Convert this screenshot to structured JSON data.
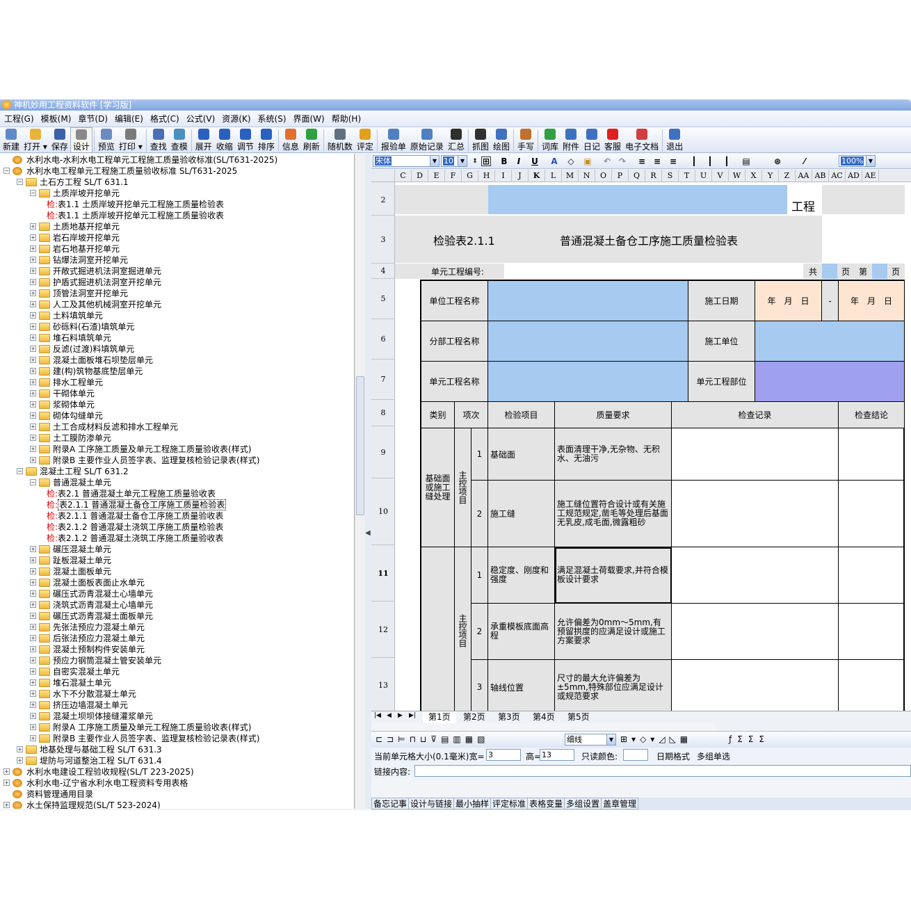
{
  "app": {
    "title": "神机妙用工程资料软件 [学习版]"
  },
  "menu": [
    "工程(G)",
    "模板(M)",
    "章节(D)",
    "编辑(E)",
    "格式(C)",
    "公式(V)",
    "资源(K)",
    "系统(S)",
    "界面(W)",
    "帮助(H)"
  ],
  "toolbar": [
    {
      "label": "新建",
      "color": "#5e8ac8"
    },
    {
      "label": "打开",
      "color": "#e9b33a",
      "dd": true
    },
    {
      "label": "保存",
      "color": "#3b64a8"
    },
    {
      "label": "设计",
      "color": "#8a8a8a",
      "pressed": true
    },
    {
      "sep": true
    },
    {
      "label": "预览",
      "color": "#6a8ac0"
    },
    {
      "label": "打印",
      "color": "#7a7a7a",
      "dd": true
    },
    {
      "sep": true
    },
    {
      "label": "查找",
      "color": "#4a6fb5"
    },
    {
      "label": "查模",
      "color": "#4a90c0"
    },
    {
      "sep": true
    },
    {
      "label": "展开",
      "color": "#2a60c0"
    },
    {
      "label": "收缩",
      "color": "#2a60c0"
    },
    {
      "label": "调节",
      "color": "#2a60c0"
    },
    {
      "label": "排序",
      "color": "#2a60c0"
    },
    {
      "sep": true
    },
    {
      "label": "信息",
      "color": "#e07030"
    },
    {
      "label": "刷新",
      "color": "#30a040"
    },
    {
      "sep": true
    },
    {
      "label": "随机数",
      "color": "#607080"
    },
    {
      "label": "评定",
      "color": "#e0a020"
    },
    {
      "sep": true
    },
    {
      "label": "报验单",
      "color": "#5080c0"
    },
    {
      "label": "原始记录",
      "color": "#5080c0"
    },
    {
      "label": "汇总",
      "color": "#303030"
    },
    {
      "sep": true
    },
    {
      "label": "抓图",
      "color": "#303030"
    },
    {
      "label": "绘图",
      "color": "#4070c0"
    },
    {
      "sep": true
    },
    {
      "label": "手写",
      "color": "#c07030"
    },
    {
      "sep": true
    },
    {
      "label": "词库",
      "color": "#30a040"
    },
    {
      "label": "附件",
      "color": "#4070c0"
    },
    {
      "label": "日记",
      "color": "#4070c0"
    },
    {
      "label": "客服",
      "color": "#e02020"
    },
    {
      "label": "电子文档",
      "color": "#d04040"
    },
    {
      "sep": true
    },
    {
      "label": "退出",
      "color": "#4070c0"
    }
  ],
  "format_bar": {
    "font": "宋体",
    "size": "10",
    "zoom": "100%",
    "bold": "B",
    "italic": "I",
    "underline": "U"
  },
  "tree": [
    {
      "t": "水利水电-水利水电工程单元工程施工质量验收标准(SL/T631-2025)",
      "lv": 0,
      "ic": "doc",
      "ex": ""
    },
    {
      "t": "水利水电工程单元工程施工质量验收标准 SL/T631-2025",
      "lv": 0,
      "ic": "doc",
      "ex": "-"
    },
    {
      "t": "土石方工程 SL/T 631.1",
      "lv": 1,
      "ic": "fold",
      "ex": "-"
    },
    {
      "t": "土质岸坡开挖单元",
      "lv": 2,
      "ic": "fold",
      "ex": "-"
    },
    {
      "t": "表1.1 土质岸坡开挖单元工程施工质量检验表",
      "lv": 3,
      "ic": "",
      "ex": "",
      "pre": "检:"
    },
    {
      "t": "表1.1 土质岸坡开挖单元工程施工质量验收表",
      "lv": 3,
      "ic": "",
      "ex": "",
      "pre": "检:"
    },
    {
      "t": "土质地基开挖单元",
      "lv": 2,
      "ic": "fold",
      "ex": "+"
    },
    {
      "t": "岩石岸坡开挖单元",
      "lv": 2,
      "ic": "fold",
      "ex": "+"
    },
    {
      "t": "岩石地基开挖单元",
      "lv": 2,
      "ic": "fold",
      "ex": "+"
    },
    {
      "t": "钻爆法洞室开挖单元",
      "lv": 2,
      "ic": "fold",
      "ex": "+"
    },
    {
      "t": "开敞式掘进机法洞室掘进单元",
      "lv": 2,
      "ic": "fold",
      "ex": "+"
    },
    {
      "t": "护盾式掘进机法洞室开挖单元",
      "lv": 2,
      "ic": "fold",
      "ex": "+"
    },
    {
      "t": "顶管法洞室开挖单元",
      "lv": 2,
      "ic": "fold",
      "ex": "+"
    },
    {
      "t": "人工及其他机械洞室开挖单元",
      "lv": 2,
      "ic": "fold",
      "ex": "+"
    },
    {
      "t": "土料填筑单元",
      "lv": 2,
      "ic": "fold",
      "ex": "+"
    },
    {
      "t": "砂砾料(石渣)填筑单元",
      "lv": 2,
      "ic": "fold",
      "ex": "+"
    },
    {
      "t": "堆石料填筑单元",
      "lv": 2,
      "ic": "fold",
      "ex": "+"
    },
    {
      "t": "反滤(过渡)料填筑单元",
      "lv": 2,
      "ic": "fold",
      "ex": "+"
    },
    {
      "t": "混凝土面板堆石坝垫层单元",
      "lv": 2,
      "ic": "fold",
      "ex": "+"
    },
    {
      "t": "建(构)筑物基底垫层单元",
      "lv": 2,
      "ic": "fold",
      "ex": "+"
    },
    {
      "t": "排水工程单元",
      "lv": 2,
      "ic": "fold",
      "ex": "+"
    },
    {
      "t": "干砌体单元",
      "lv": 2,
      "ic": "fold",
      "ex": "+"
    },
    {
      "t": "浆砌体单元",
      "lv": 2,
      "ic": "fold",
      "ex": "+"
    },
    {
      "t": "砌体勾缝单元",
      "lv": 2,
      "ic": "fold",
      "ex": "+"
    },
    {
      "t": "土工合成材料反滤和排水工程单元",
      "lv": 2,
      "ic": "fold",
      "ex": "+"
    },
    {
      "t": "土工膜防渗单元",
      "lv": 2,
      "ic": "fold",
      "ex": "+"
    },
    {
      "t": "附录A 工序施工质量及单元工程施工质量验收表(样式)",
      "lv": 2,
      "ic": "fold",
      "ex": "+"
    },
    {
      "t": "附录B 主要作业人员签字表、监理复核检验记录表(样式)",
      "lv": 2,
      "ic": "fold",
      "ex": "+"
    },
    {
      "t": "混凝土工程 SL/T 631.2",
      "lv": 1,
      "ic": "fold",
      "ex": "-"
    },
    {
      "t": "普通混凝土单元",
      "lv": 2,
      "ic": "fold",
      "ex": "-"
    },
    {
      "t": "表2.1 普通混凝土单元工程施工质量验收表",
      "lv": 3,
      "ic": "",
      "ex": "",
      "pre": "检:"
    },
    {
      "t": "表2.1.1 普通混凝土备仓工序施工质量检验表",
      "lv": 3,
      "ic": "",
      "ex": "",
      "pre": "检:",
      "sel": true
    },
    {
      "t": "表2.1.1 普通混凝土备仓工序施工质量验收表",
      "lv": 3,
      "ic": "",
      "ex": "",
      "pre": "检:"
    },
    {
      "t": "表2.1.2 普通混凝土浇筑工序施工质量检验表",
      "lv": 3,
      "ic": "",
      "ex": "",
      "pre": "检:"
    },
    {
      "t": "表2.1.2 普通混凝土浇筑工序施工质量验收表",
      "lv": 3,
      "ic": "",
      "ex": "",
      "pre": "检:"
    },
    {
      "t": "碾压混凝土单元",
      "lv": 2,
      "ic": "fold",
      "ex": "+"
    },
    {
      "t": "趾板混凝土单元",
      "lv": 2,
      "ic": "fold",
      "ex": "+"
    },
    {
      "t": "混凝土面板单元",
      "lv": 2,
      "ic": "fold",
      "ex": "+"
    },
    {
      "t": "混凝土面板表面止水单元",
      "lv": 2,
      "ic": "fold",
      "ex": "+"
    },
    {
      "t": "碾压式沥青混凝土心墙单元",
      "lv": 2,
      "ic": "fold",
      "ex": "+"
    },
    {
      "t": "浇筑式沥青混凝土心墙单元",
      "lv": 2,
      "ic": "fold",
      "ex": "+"
    },
    {
      "t": "碾压式沥青混凝土面板单元",
      "lv": 2,
      "ic": "fold",
      "ex": "+"
    },
    {
      "t": "先张法预应力混凝土单元",
      "lv": 2,
      "ic": "fold",
      "ex": "+"
    },
    {
      "t": "后张法预应力混凝土单元",
      "lv": 2,
      "ic": "fold",
      "ex": "+"
    },
    {
      "t": "混凝土预制构件安装单元",
      "lv": 2,
      "ic": "fold",
      "ex": "+"
    },
    {
      "t": "预应力钢筒混凝土管安装单元",
      "lv": 2,
      "ic": "fold",
      "ex": "+"
    },
    {
      "t": "自密实混凝土单元",
      "lv": 2,
      "ic": "fold",
      "ex": "+"
    },
    {
      "t": "堆石混凝土单元",
      "lv": 2,
      "ic": "fold",
      "ex": "+"
    },
    {
      "t": "水下不分散混凝土单元",
      "lv": 2,
      "ic": "fold",
      "ex": "+"
    },
    {
      "t": "挤压边墙混凝土单元",
      "lv": 2,
      "ic": "fold",
      "ex": "+"
    },
    {
      "t": "混凝土坝坝体接缝灌浆单元",
      "lv": 2,
      "ic": "fold",
      "ex": "+"
    },
    {
      "t": "附录A 工序施工质量及单元工程施工质量验收表(样式)",
      "lv": 2,
      "ic": "fold",
      "ex": "+"
    },
    {
      "t": "附录B 主要作业人员签字表、监理复核检验记录表(样式)",
      "lv": 2,
      "ic": "fold",
      "ex": "+"
    },
    {
      "t": "地基处理与基础工程 SL/T 631.3",
      "lv": 1,
      "ic": "fold",
      "ex": "+"
    },
    {
      "t": "堤防与河道整治工程 SL/T 631.4",
      "lv": 1,
      "ic": "fold",
      "ex": "+"
    },
    {
      "t": "水利水电建设工程验收规程(SL/T 223-2025)",
      "lv": 0,
      "ic": "doc",
      "ex": "+"
    },
    {
      "t": "水利水电-辽宁省水利水电工程资料专用表格",
      "lv": 0,
      "ic": "doc",
      "ex": "+"
    },
    {
      "t": "资料管理通用目录",
      "lv": 0,
      "ic": "doc",
      "ex": ""
    },
    {
      "t": "水土保持监理规范(SL/T 523-2024)",
      "lv": 0,
      "ic": "doc",
      "ex": "+"
    }
  ],
  "columns": [
    "C",
    "D",
    "E",
    "F",
    "G",
    "H",
    "I",
    "J",
    "K",
    "L",
    "M",
    "N",
    "O",
    "P",
    "Q",
    "R",
    "S",
    "T",
    "U",
    "V",
    "W",
    "X",
    "Y",
    "Z",
    "AA",
    "AB",
    "AC",
    "AD",
    "AE"
  ],
  "rows": [
    "2",
    "3",
    "4",
    "5",
    "6",
    "7",
    "8",
    "9",
    "10",
    "11",
    "12",
    "13"
  ],
  "form": {
    "suffix": "工程",
    "table_no": "检验表2.1.1",
    "title": "普通混凝土备仓工序施工质量检验表",
    "unit_no_label": "单元工程编号:",
    "total": "共",
    "page": "页",
    "page_no": "第",
    "page2": "页",
    "unit_project": "单位工程名称",
    "start_date": "施工日期",
    "date1": "年　月　日",
    "dash": "-",
    "date2": "年　月　日",
    "sub_project": "分部工程名称",
    "contractor": "施工单位",
    "unit_name": "单元工程名称",
    "unit_part": "单元工程部位",
    "h_cat": "类别",
    "h_item": "项次",
    "h_check": "检验项目",
    "h_req": "质量要求",
    "h_record": "检查记录",
    "h_result": "检查结论",
    "cat1": "基础面或施工缝处理",
    "main1": "主控项目",
    "main2": "主控项目",
    "r9_no": "1",
    "r9_item": "基础面",
    "r9_req": "表面清理干净,无杂物、无积水、无油污",
    "r10_no": "2",
    "r10_item": "施工缝",
    "r10_req": "施工缝位置符合设计或有关施工规范规定,凿毛等处理后基面无乳皮,成毛面,微露粗砂",
    "r11_no": "1",
    "r11_item": "稳定度、刚度和强度",
    "r11_req": "满足混凝土荷载要求,并符合模板设计要求",
    "r12_no": "2",
    "r12_item": "承重模板底面高程",
    "r12_req": "允许偏差为0mm～5mm,有预留拱度的应满足设计或施工方案要求",
    "r13_no": "3",
    "r13_item": "轴线位置",
    "r13_req": "尺寸的最大允许偏差为±5mm,特殊部位应满足设计或规范要求"
  },
  "sheets": [
    "第1页",
    "第2页",
    "第3页",
    "第4页",
    "第5页"
  ],
  "bottom": {
    "line_style": "细线",
    "size_label": "当前单元格大小(0.1毫米)宽=",
    "w": "3",
    "h_label": "高=",
    "h": "13",
    "readonly": "只读颜色:",
    "date_fmt": "日期格式",
    "multi": "多组单选",
    "link_label": "链接内容:"
  },
  "bottom_tabs": [
    "备忘记事",
    "设计与链接",
    "最小抽样",
    "评定标准",
    "表格变量",
    "多组设置",
    "盖章管理"
  ]
}
